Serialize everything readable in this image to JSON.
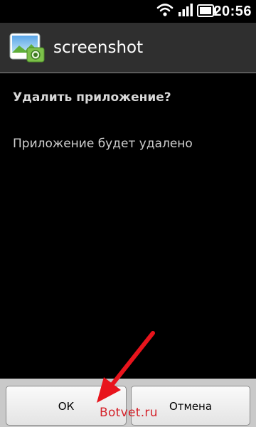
{
  "status_bar": {
    "clock": "20:56",
    "icons": [
      "wifi-icon",
      "signal-icon",
      "battery-icon"
    ]
  },
  "app": {
    "title": "screenshot",
    "icon": "image-gallery-icon"
  },
  "dialog": {
    "heading": "Удалить приложение?",
    "message": "Приложение будет удалено",
    "ok_label": "ОК",
    "cancel_label": "Отмена"
  },
  "annotation": {
    "arrow_color": "#e8141c",
    "watermark": "Botvet.ru"
  },
  "colors": {
    "background": "#000000",
    "header": "#2f2f2f",
    "button_bar": "#c9c9c9"
  }
}
